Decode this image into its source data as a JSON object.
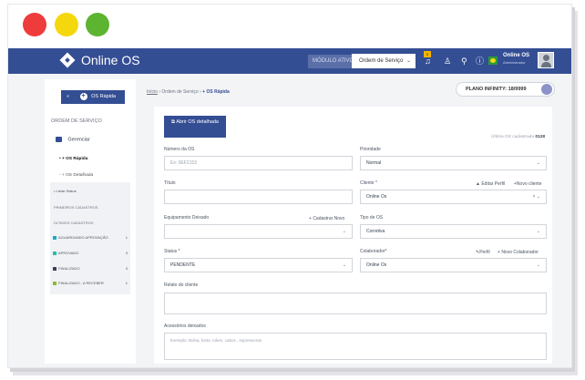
{
  "window_controls": [
    "close",
    "minimize",
    "maximize"
  ],
  "topbar": {
    "brand": "Online OS",
    "modulo_label": "MÓDULO ATIVO",
    "modulo_value": "Ordem de Serviço",
    "notif_count": "0",
    "user_name": "Online OS",
    "user_role": "Administrador"
  },
  "sidebar": {
    "quick_button": "OS Rápida",
    "section_title": "ORDEM DE SERVIÇO",
    "manage_label": "Gerenciar",
    "sub_items": [
      "+ OS Rápida",
      "+ OS Detalhada",
      "Listar Status"
    ],
    "first_reg": "PRIMEIROS CADASTROS",
    "last_reg": "ÚLTIMOS CADASTROS",
    "statuses": [
      {
        "label": "AGUARDANDO APROVAÇÃO",
        "count": "1",
        "color": "#1ea7c9"
      },
      {
        "label": "APROVADO",
        "count": "3",
        "color": "#22c1a8"
      },
      {
        "label": "FINALIZADO",
        "count": "3",
        "color": "#3b3f5c"
      },
      {
        "label": "FINALIZADO - A RECEBER",
        "count": "1",
        "color": "#8dbb2a"
      }
    ]
  },
  "breadcrumb": {
    "home": "Início",
    "parent": "Ordem de Serviço",
    "current": "+ OS Rápida"
  },
  "plan": "PLANO INFINITY: 18/9999",
  "main": {
    "open_detailed": "Abrir OS detalhada",
    "last_os_label": "Última OS cadastrada",
    "last_os_value": "0128",
    "numero_label": "Número da OS",
    "numero_placeholder": "Ex: 0EF2153",
    "prioridade_label": "Prioridade",
    "prioridade_value": "Normal",
    "titulo_label": "Título",
    "cliente_label": "Cliente *",
    "editar_perfil": "Editar Perfil",
    "novo_cliente": "Novo cliente",
    "cliente_value": "Online Os",
    "equip_label": "Equipamento Deixado",
    "cadastrar_novo": "Cadastrar Novo",
    "tipo_label": "Tipo de OS",
    "tipo_value": "Corretiva",
    "status_label": "Status *",
    "status_value": "PENDENTE",
    "colab_label": "Colaborador*",
    "perfil": "Perfil",
    "novo_colab": "Novo Colaborador",
    "colab_value": "Online Os",
    "relato_label": "Relato do cliente",
    "acessorios_label": "Acessórios deixados",
    "acessorios_placeholder": "Exemplo: Bolsa, fonte, token, cabos , impressoras"
  }
}
